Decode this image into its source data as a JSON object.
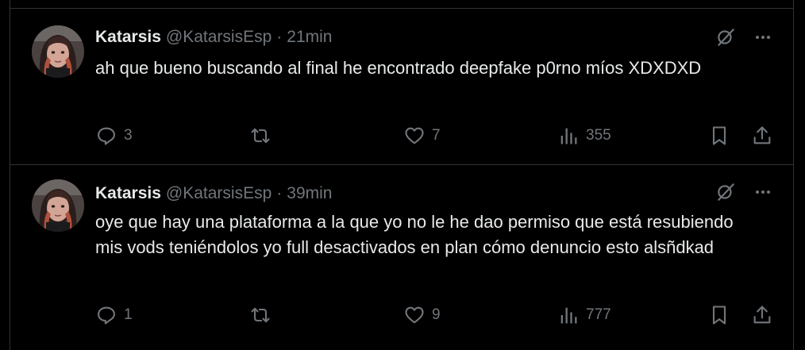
{
  "tweets": [
    {
      "name": "Katarsis",
      "handle": "@KatarsisEsp",
      "separator": "·",
      "time": "21min",
      "text": "ah que bueno buscando al final he encontrado deepfake p0rno míos XDXDXD",
      "replies": "3",
      "retweets": "",
      "likes": "7",
      "views": "355"
    },
    {
      "name": "Katarsis",
      "handle": "@KatarsisEsp",
      "separator": "·",
      "time": "39min",
      "text": "oye que hay una plataforma a la que yo no le he dao permiso que está resubiendo mis vods teniéndolos yo full desactivados en plan cómo denuncio esto alsñdkad",
      "replies": "1",
      "retweets": "",
      "likes": "9",
      "views": "777"
    }
  ],
  "icons": {
    "reply": "reply-icon",
    "retweet": "retweet-icon",
    "like": "heart-icon",
    "views": "views-icon",
    "bookmark": "bookmark-icon",
    "share": "share-icon",
    "grok": "grok-icon",
    "more": "more-icon"
  },
  "colors": {
    "background": "#000000",
    "text": "#e7e9ea",
    "secondary": "#71767b",
    "border": "#2f3336"
  }
}
